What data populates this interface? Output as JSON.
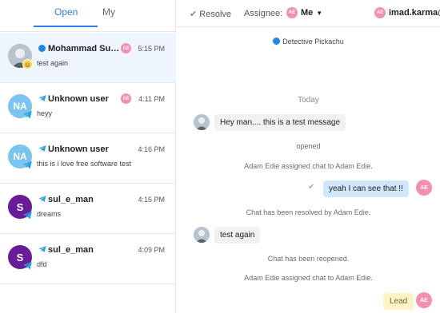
{
  "tabs": {
    "open": "Open",
    "my": "My"
  },
  "conversations": [
    {
      "name": "Mohammad Sule...",
      "snippet": "test again",
      "time": "5:15 PM",
      "assignee": "AE",
      "avatar": "photo",
      "channel": "messenger",
      "active": true
    },
    {
      "name": "Unknown user",
      "snippet": "heyy",
      "time": "4:11 PM",
      "assignee": "AE",
      "avatar": "NA",
      "channel": "telegram",
      "active": false
    },
    {
      "name": "Unknown user",
      "snippet": "this is i love free software test",
      "time": "4:16 PM",
      "assignee": "",
      "avatar": "NA",
      "channel": "telegram",
      "active": false
    },
    {
      "name": "sul_e_man",
      "snippet": "dreams",
      "time": "4:15 PM",
      "assignee": "",
      "avatar": "S",
      "channel": "telegram",
      "active": false
    },
    {
      "name": "sul_e_man",
      "snippet": "dfd",
      "time": "4:09 PM",
      "assignee": "",
      "avatar": "S",
      "channel": "telegram",
      "active": false
    }
  ],
  "topbar": {
    "resolve": "Resolve",
    "assignee_label": "Assignee:",
    "assignee_initials": "AE",
    "assignee_value": "Me",
    "user_initials": "AE",
    "user_name": "imad.karma@"
  },
  "chat": {
    "source": "Detective Pickachu",
    "day_separator": "Today",
    "messages": [
      {
        "kind": "incoming",
        "text": "Hey man.... this is a test message"
      },
      {
        "kind": "system",
        "text": "opened"
      },
      {
        "kind": "system",
        "text": "Adam Edie assigned chat to Adam Edie."
      },
      {
        "kind": "outgoing",
        "text": "yeah I can see that !!",
        "initials": "AE"
      },
      {
        "kind": "system",
        "text": "Chat has been resolved by Adam Edie."
      },
      {
        "kind": "incoming",
        "text": "test again"
      },
      {
        "kind": "system",
        "text": "Chat has been reopened."
      },
      {
        "kind": "system",
        "text": "Adam Edie assigned chat to Adam Edie."
      },
      {
        "kind": "lead",
        "text": "Lead",
        "initials": "AE"
      }
    ]
  },
  "colors": {
    "accent": "#2f80ed",
    "active_row": "#eef5fd",
    "outgoing_bubble": "#cfe6fb",
    "assignee_badge": "#f48fb1",
    "lead_bubble": "#fff4c7"
  }
}
